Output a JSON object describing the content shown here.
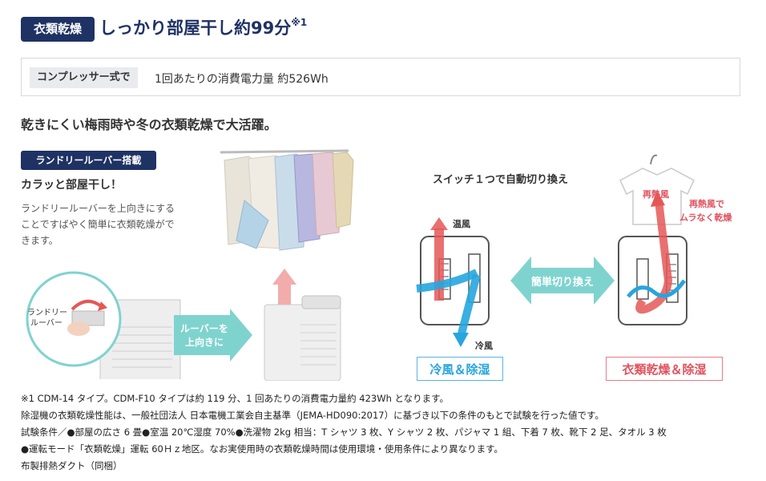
{
  "header": {
    "badge": "衣類乾燥",
    "title": "しっかり部屋干し約99分",
    "footnote_mark": "※1"
  },
  "info": {
    "label": "コンプレッサー式で",
    "value": "1回あたりの消費電力量 約526Wh"
  },
  "subhead": "乾きにくい梅雨時や冬の衣類乾燥で大活躍。",
  "louver": {
    "tag": "ランドリールーバー搭載",
    "title": "カラッと部屋干し！",
    "description": "ランドリールーバーを上向きにすることですばやく簡単に衣類乾燥ができます。",
    "circle_label": "ランドリー\nルーバー",
    "arrow_label_1": "ルーバーを",
    "arrow_label_2": "上向きに"
  },
  "switch": {
    "title": "スイッチ１つで自動切り換え",
    "warm_air": "温風",
    "cold_air": "冷風",
    "easy_switch": "簡単切り換え",
    "reheat": "再熱風",
    "reheat_note_1": "再熱風で",
    "reheat_note_2": "ムラなく乾燥",
    "mode_cool": "冷風＆除湿",
    "mode_dry": "衣類乾燥＆除湿"
  },
  "notes": [
    "※1 CDM-14 タイプ。CDM-F10 タイプは約 119 分、1 回あたりの消費電力量約 423Wh となります。",
    "除湿機の衣類乾燥性能は、一般社団法人 日本電機工業会自主基準（JEMA-HD090:2017）に基づき以下の条件のもとで試験を行った値です。",
    "試験条件／●部屋の広さ 6 畳●室温 20℃湿度 70%●洗濯物 2kg 相当：T シャツ 3 枚、Y シャツ 2 枚、パジャマ 1 組、下着 7 枚、靴下 2 足、タオル 3 枚",
    "●運転モード「衣類乾燥」運転 60Ｈｚ地区。なお実使用時の衣類乾燥時間は使用環境・使用条件により異なります。",
    "布製排熱ダクト（同梱）"
  ],
  "colors": {
    "navy": "#1f3264",
    "cool_blue": "#27a5de",
    "warm_red": "#e0525e",
    "teal_arrow": "#7fd3cf"
  }
}
